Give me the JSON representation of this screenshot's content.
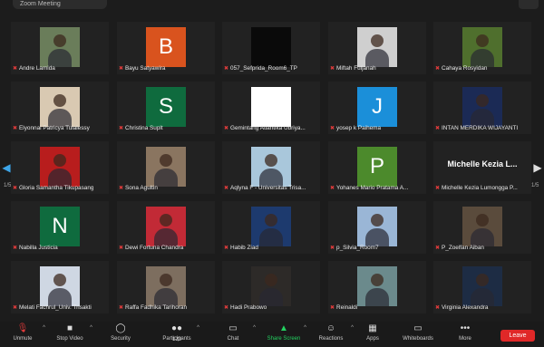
{
  "window": {
    "title": "Zoom Meeting"
  },
  "pagination": {
    "left": "1/5",
    "right": "1/5"
  },
  "tiles": [
    {
      "name": "Andre Lamida",
      "kind": "photo",
      "bg": "#6a7d5a"
    },
    {
      "name": "Bayu Satyawira",
      "kind": "letter",
      "letter": "B",
      "bg": "#d9531e"
    },
    {
      "name": "057_Sefprida_Room6_TP",
      "kind": "blank",
      "bg": "#0a0a0a"
    },
    {
      "name": "Miftah Fuljanah",
      "kind": "photo",
      "bg": "#cfcfcf"
    },
    {
      "name": "Cahaya Rosyidan",
      "kind": "photo",
      "bg": "#4f6f2d"
    },
    {
      "name": "Elyonnai Patricya Tulalessy",
      "kind": "photo",
      "bg": "#d9c9b2"
    },
    {
      "name": "Christina Suplt",
      "kind": "letter",
      "letter": "S",
      "bg": "#0f6b3e"
    },
    {
      "name": "Gemintang Atlantika Ubriya...",
      "kind": "blank",
      "bg": "#ffffff"
    },
    {
      "name": "yosep k Paihema",
      "kind": "letter",
      "letter": "J",
      "bg": "#1b8fd9"
    },
    {
      "name": "INTAN MERDIKA WIJAYANTI",
      "kind": "photo",
      "bg": "#1b2a55"
    },
    {
      "name": "Gloria Samantha Tikupasang",
      "kind": "photo",
      "bg": "#b81d1d"
    },
    {
      "name": "Sona Agultin",
      "kind": "photo",
      "bg": "#8a7560"
    },
    {
      "name": "Aqlyna F - Universitas Trisa...",
      "kind": "photo",
      "bg": "#a9c7db"
    },
    {
      "name": "Yohanes Mario Pratama A...",
      "kind": "letter",
      "letter": "P",
      "bg": "#4c8a2c"
    },
    {
      "name": "Michelle Kezia Lumongga P...",
      "kind": "text",
      "display": "Michelle Kezia L...",
      "bg": "#222222"
    },
    {
      "name": "Nabilla Justicia",
      "kind": "letter",
      "letter": "N",
      "bg": "#0f6b3e"
    },
    {
      "name": "Dewi Fortuna Chandra",
      "kind": "photo",
      "bg": "#c22a36"
    },
    {
      "name": "Habib Ziad",
      "kind": "photo",
      "bg": "#1d3a6e"
    },
    {
      "name": "p_Silvia_Room7",
      "kind": "photo",
      "bg": "#9ab6d6"
    },
    {
      "name": "P_Zoelfan Aiban",
      "kind": "photo",
      "bg": "#5a4b3c"
    },
    {
      "name": "Melati Fachrul_Univ. Trisakti",
      "kind": "photo",
      "bg": "#cfd7e3"
    },
    {
      "name": "Raffa Fadhika Tarihoran",
      "kind": "photo",
      "bg": "#7d6e5f"
    },
    {
      "name": "Hadi Prabowo",
      "kind": "photo",
      "bg": "#2d2a28"
    },
    {
      "name": "Reinaldi",
      "kind": "photo",
      "bg": "#6b8a8c"
    },
    {
      "name": "Virginia Alexandra",
      "kind": "photo",
      "bg": "#1d2c44"
    }
  ],
  "toolbar": {
    "unmute": "Unmute",
    "stop_video": "Stop Video",
    "security": "Security",
    "participants": "Participants",
    "participants_count": "123",
    "chat": "Chat",
    "share_screen": "Share Screen",
    "reactions": "Reactions",
    "apps": "Apps",
    "whiteboards": "Whiteboards",
    "more": "More",
    "leave": "Leave"
  },
  "colors": {
    "accent_green": "#23d160",
    "leave_red": "#e02828",
    "muted_red": "#e23b3b"
  }
}
